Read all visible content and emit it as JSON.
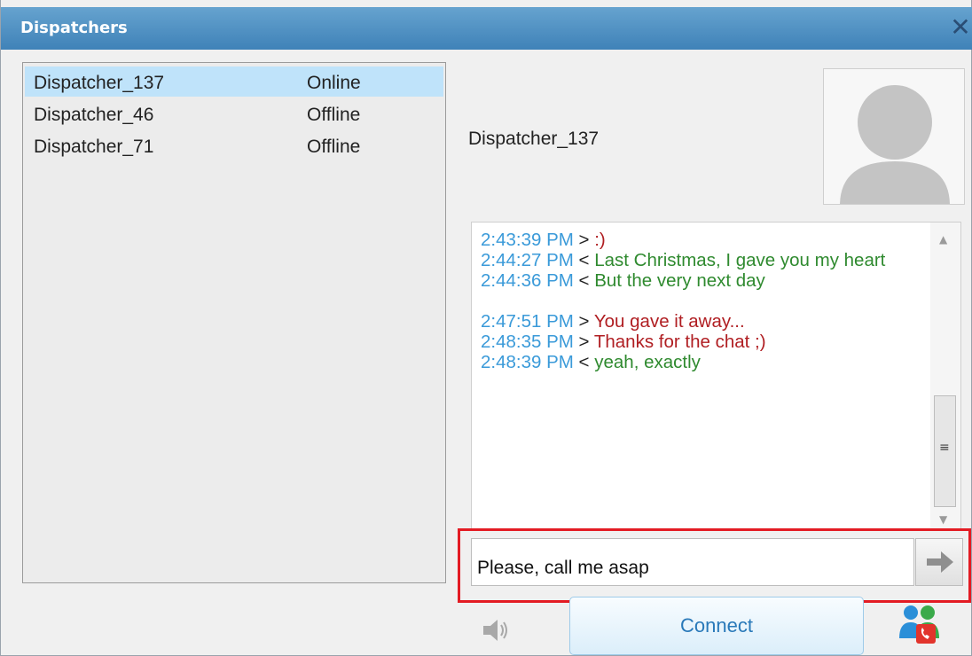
{
  "window": {
    "title": "Dispatchers",
    "close_glyph": "✕"
  },
  "dispatchers": [
    {
      "name": "Dispatcher_137",
      "status": "Online",
      "selected": true
    },
    {
      "name": "Dispatcher_46",
      "status": "Offline",
      "selected": false
    },
    {
      "name": "Dispatcher_71",
      "status": "Offline",
      "selected": false
    }
  ],
  "selected_dispatcher": {
    "name": "Dispatcher_137",
    "avatar_icon": "user-placeholder-icon"
  },
  "chat": {
    "messages": [
      {
        "time": "2:43:39 PM",
        "dir": ">",
        "text": ":)",
        "type": "out"
      },
      {
        "time": "2:44:27 PM",
        "dir": "<",
        "text": "Last Christmas, I gave you my heart",
        "type": "in"
      },
      {
        "time": "2:44:36 PM",
        "dir": "<",
        "text": "But the very next day",
        "type": "in"
      },
      {
        "time": "2:47:51 PM",
        "dir": ">",
        "text": "You gave it away...",
        "type": "out"
      },
      {
        "time": "2:48:35 PM",
        "dir": ">",
        "text": "Thanks for the chat ;)",
        "type": "out"
      },
      {
        "time": "2:48:39 PM",
        "dir": "<",
        "text": "yeah, exactly",
        "type": "in"
      }
    ],
    "input_value": "Please, call me asap",
    "send_icon": "arrow-right-icon"
  },
  "footer": {
    "connect_label": "Connect",
    "speaker_icon": "speaker-icon",
    "call_user_icon": "users-call-icon"
  },
  "colors": {
    "titlebar": "#4a8cc0",
    "timestamp": "#3a9ad9",
    "outgoing": "#b01e22",
    "incoming": "#2f8a2f",
    "selection": "#bfe3fa",
    "highlight_frame": "#e31b23"
  }
}
